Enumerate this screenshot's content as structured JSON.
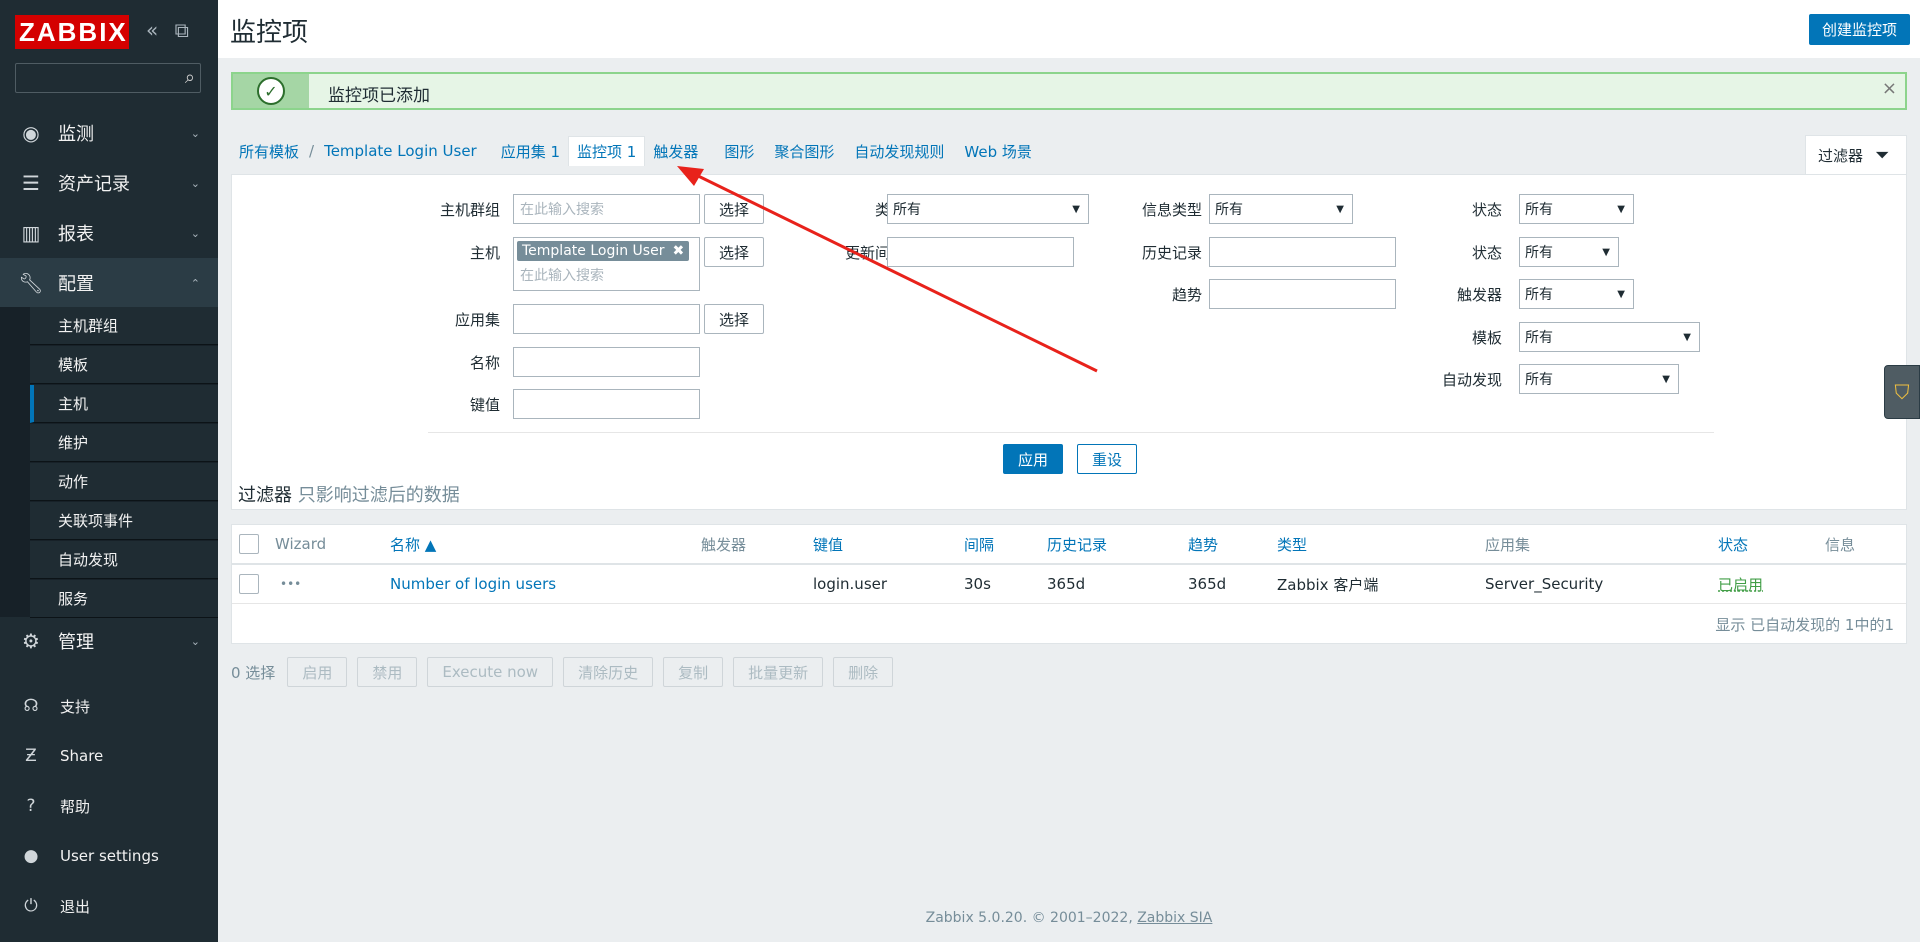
{
  "sidebar": {
    "logo": "ZABBIX",
    "collapse_icon": "«",
    "expand_icon": "⧉",
    "menu": [
      {
        "label": "监测",
        "icon": "eye-icon"
      },
      {
        "label": "资产记录",
        "icon": "list-icon"
      },
      {
        "label": "报表",
        "icon": "bar-chart-icon"
      },
      {
        "label": "配置",
        "icon": "wrench-icon"
      },
      {
        "label": "管理",
        "icon": "gear-icon"
      }
    ],
    "submenu": [
      "主机群组",
      "模板",
      "主机",
      "维护",
      "动作",
      "关联项事件",
      "自动发现",
      "服务"
    ],
    "bottom": [
      {
        "label": "支持",
        "icon": "headset-icon"
      },
      {
        "label": "Share",
        "icon": "share-icon"
      },
      {
        "label": "帮助",
        "icon": "help-icon"
      },
      {
        "label": "User settings",
        "icon": "user-icon"
      },
      {
        "label": "退出",
        "icon": "power-icon"
      }
    ]
  },
  "header": {
    "title": "监控项",
    "create_button": "创建监控项"
  },
  "message": {
    "text": "监控项已添加",
    "close": "×"
  },
  "breadcrumbs": {
    "all_templates": "所有模板",
    "template": "Template Login User",
    "applications": "应用集 1",
    "items": "监控项 1",
    "triggers": "触发器",
    "graphs": "图形",
    "screens": "聚合图形",
    "discovery": "自动发现规则",
    "web": "Web 场景"
  },
  "filter_tab": {
    "label": "过滤器"
  },
  "filter": {
    "host_group_label": "主机群组",
    "host_group_placeholder": "在此输入搜索",
    "select_label": "选择",
    "host_label": "主机",
    "host_chip": "Template Login User",
    "host_placeholder": "在此输入搜索",
    "application_label": "应用集",
    "name_label": "名称",
    "key_label": "键值",
    "type_label": "类型",
    "type_value": "所有",
    "interval_label": "更新间隔",
    "info_type_label": "信息类型",
    "info_type_value": "所有",
    "history_label": "历史记录",
    "trends_label": "趋势",
    "state_label": "状态",
    "state_value": "所有",
    "status_label": "状态",
    "status_value": "所有",
    "triggers_label": "触发器",
    "triggers_value": "所有",
    "template_label": "模板",
    "template_value": "所有",
    "discovery_label": "自动发现",
    "discovery_value": "所有",
    "apply": "应用",
    "reset": "重设",
    "note_main": "过滤器",
    "note_sub": " 只影响过滤后的数据"
  },
  "table": {
    "headers": {
      "wizard": "Wizard",
      "name": "名称 ▲",
      "triggers": "触发器",
      "key": "键值",
      "interval": "间隔",
      "history": "历史记录",
      "trends": "趋势",
      "type": "类型",
      "applications": "应用集",
      "status": "状态",
      "info": "信息"
    },
    "rows": [
      {
        "wizard": "•••",
        "name": "Number of login users",
        "key": "login.user",
        "interval": "30s",
        "history": "365d",
        "trends": "365d",
        "type": "Zabbix 客户端",
        "applications": "Server_Security",
        "status": "已启用"
      }
    ],
    "footer": "显示 已自动发现的 1中的1"
  },
  "bulk": {
    "selected": "0 选择",
    "buttons": [
      "启用",
      "禁用",
      "Execute now",
      "清除历史",
      "复制",
      "批量更新",
      "删除"
    ]
  },
  "footer": {
    "text": "Zabbix 5.0.20. © 2001–2022, ",
    "link": "Zabbix SIA"
  },
  "colors": {
    "accent": "#0275b8",
    "sidebar": "#1f2c33",
    "logo": "#d40000",
    "enabled": "#429e47",
    "arrow": "#e8221b"
  }
}
